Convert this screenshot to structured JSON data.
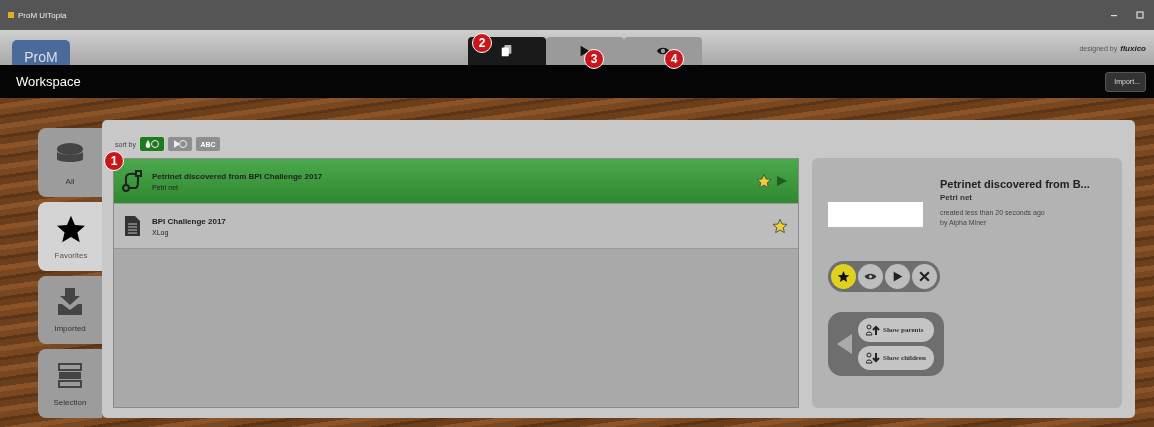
{
  "window": {
    "title": "ProM UITopia"
  },
  "header": {
    "logo": "ProM",
    "credit": "designed by",
    "brand": "fluxico"
  },
  "view_tabs": [
    {
      "kind": "copy",
      "selected": true,
      "badge": "2"
    },
    {
      "kind": "play",
      "selected": false,
      "badge": "3"
    },
    {
      "kind": "eye",
      "selected": false,
      "badge": "4"
    }
  ],
  "workspace_bar": {
    "title": "Workspace",
    "import_button": "Import..."
  },
  "side_tabs": [
    {
      "kind": "all",
      "label": "All",
      "selected": false
    },
    {
      "kind": "favorites",
      "label": "Favorites",
      "selected": true
    },
    {
      "kind": "imported",
      "label": "Imported",
      "selected": false
    },
    {
      "kind": "selection",
      "label": "Selection",
      "selected": false
    }
  ],
  "sort": {
    "label": "sort by",
    "options": [
      {
        "kind": "type",
        "selected": true
      },
      {
        "kind": "time",
        "selected": false
      },
      {
        "kind": "name",
        "label": "ABC",
        "selected": false
      }
    ]
  },
  "list_badge": "1",
  "resources": [
    {
      "kind": "petrinet",
      "name": "Petrinet discovered from BPI Challenge 2017",
      "type": "Petri net",
      "selected": true,
      "favorite": true
    },
    {
      "kind": "log",
      "name": "BPI Challenge 2017",
      "type": "XLog",
      "selected": false,
      "favorite": true
    }
  ],
  "detail": {
    "name": "Petrinet discovered from B...",
    "type": "Petri net",
    "created": "created less than 20 seconds ago",
    "author": "by Alpha Miner",
    "favorite": true,
    "relations": [
      {
        "kind": "parents",
        "label": "Show parents"
      },
      {
        "kind": "children",
        "label": "Show children"
      }
    ]
  }
}
